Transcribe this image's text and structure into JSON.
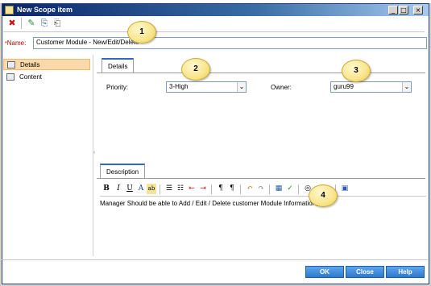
{
  "window": {
    "title": "New Scope item",
    "minimize": "_",
    "maximize": "□",
    "close": "×"
  },
  "toolbar": {
    "delete_glyph": "✖",
    "icon2_glyph": "✎",
    "icon3_glyph": "⎘",
    "icon4_glyph": "⎗"
  },
  "name_field": {
    "label": "Name:",
    "required_marker": "*",
    "value": "Customer Module - New/Edit/Delete"
  },
  "sidebar": {
    "items": [
      {
        "label": "Details"
      },
      {
        "label": "Content"
      }
    ],
    "grip": "‹"
  },
  "details": {
    "tab_label": "Details",
    "priority_label": "Priority:",
    "priority_value": "3-High",
    "owner_label": "Owner:",
    "owner_value": "guru99",
    "arrow": "⌄"
  },
  "description": {
    "tab_label": "Description",
    "text": "Manager Should be able to Add / Edit / Delete customer Module Information",
    "rt": {
      "bold": "B",
      "italic": "I",
      "underline": "U",
      "font_color": "A",
      "highlight": "ab",
      "bullets": "☰",
      "numbered": "☷",
      "outdent": "⇤",
      "indent": "⇥",
      "ltr": "¶",
      "rtl": "¶",
      "undo": "↶",
      "redo": "↷",
      "table": "▦",
      "spell": "✓",
      "link": "◎",
      "calendar": "▣"
    }
  },
  "callouts": [
    "1",
    "2",
    "3",
    "4"
  ],
  "buttons": {
    "ok": "OK",
    "close": "Close",
    "help": "Help"
  },
  "colors": {
    "button_blue": "#2c79cc",
    "required_red": "#c00000",
    "selection": "#fbd9a8"
  }
}
